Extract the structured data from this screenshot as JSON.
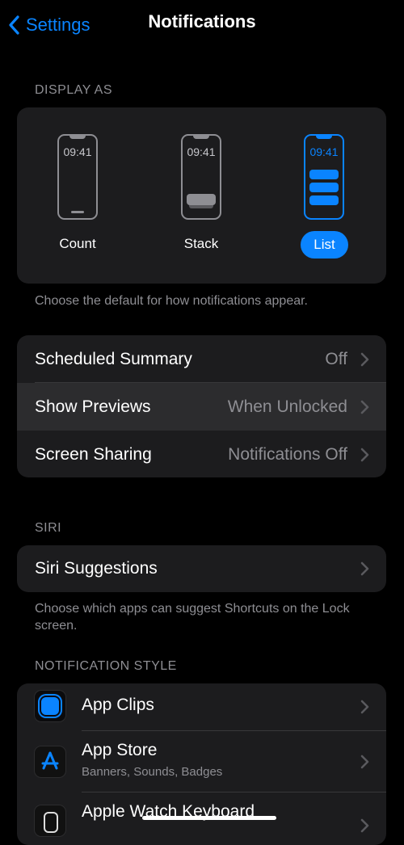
{
  "nav": {
    "back_label": "Settings",
    "title": "Notifications"
  },
  "display_as": {
    "header": "DISPLAY AS",
    "time": "09:41",
    "options": [
      {
        "label": "Count"
      },
      {
        "label": "Stack"
      },
      {
        "label": "List",
        "selected": true
      }
    ],
    "footer": "Choose the default for how notifications appear."
  },
  "settings_rows": [
    {
      "label": "Scheduled Summary",
      "value": "Off"
    },
    {
      "label": "Show Previews",
      "value": "When Unlocked"
    },
    {
      "label": "Screen Sharing",
      "value": "Notifications Off"
    }
  ],
  "siri": {
    "header": "SIRI",
    "row_label": "Siri Suggestions",
    "footer": "Choose which apps can suggest Shortcuts on the Lock screen."
  },
  "notification_style": {
    "header": "NOTIFICATION STYLE",
    "apps": [
      {
        "name": "App Clips",
        "subtitle": ""
      },
      {
        "name": "App Store",
        "subtitle": "Banners, Sounds, Badges"
      },
      {
        "name": "Apple Watch Keyboard",
        "subtitle": ""
      }
    ]
  },
  "colors": {
    "accent": "#0a84ff",
    "card": "#1c1c1e",
    "secondary_text": "#8e8e93",
    "background": "#000000"
  }
}
